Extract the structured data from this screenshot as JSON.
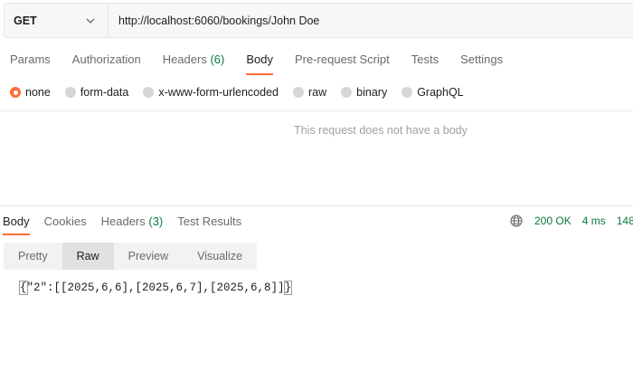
{
  "request": {
    "method": "GET",
    "url": "http://localhost:6060/bookings/John Doe"
  },
  "request_tabs": [
    {
      "label": "Params"
    },
    {
      "label": "Authorization"
    },
    {
      "label": "Headers",
      "count": "(6)"
    },
    {
      "label": "Body",
      "active": true
    },
    {
      "label": "Pre-request Script"
    },
    {
      "label": "Tests"
    },
    {
      "label": "Settings"
    }
  ],
  "body_types": [
    {
      "label": "none",
      "selected": true
    },
    {
      "label": "form-data"
    },
    {
      "label": "x-www-form-urlencoded"
    },
    {
      "label": "raw"
    },
    {
      "label": "binary"
    },
    {
      "label": "GraphQL"
    }
  ],
  "empty_body_message": "This request does not have a body",
  "response_tabs": [
    {
      "label": "Body",
      "active": true
    },
    {
      "label": "Cookies"
    },
    {
      "label": "Headers",
      "count": "(3)"
    },
    {
      "label": "Test Results"
    }
  ],
  "response": {
    "status": "200 OK",
    "time": "4 ms",
    "size": "148"
  },
  "view_modes": [
    {
      "label": "Pretty"
    },
    {
      "label": "Raw",
      "active": true
    },
    {
      "label": "Preview"
    },
    {
      "label": "Visualize"
    }
  ],
  "raw_body": {
    "open": "{",
    "content": "\"2\":[[2025,6,6],[2025,6,7],[2025,6,8]]",
    "close": "}"
  },
  "colors": {
    "accent": "#ff6c37",
    "success": "#0b7a3e"
  },
  "icons": {
    "method_dropdown": "chevron-down-icon",
    "network": "globe-icon"
  }
}
